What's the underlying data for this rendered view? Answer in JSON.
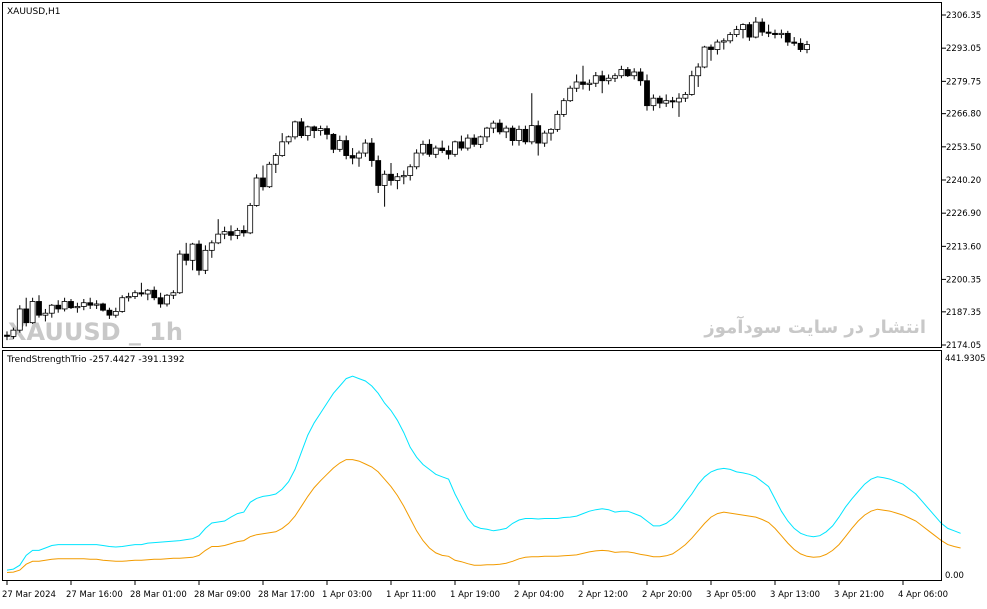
{
  "window": {
    "symbol_label": "XAUUSD,H1"
  },
  "watermark": {
    "symbol": "XAUUSD _ 1h",
    "persian": "انتشار در سایت سودآموز"
  },
  "indicator": {
    "label": "TrendStrengthTrio -257.4427 -391.1392"
  },
  "colors": {
    "background": "#ffffff",
    "border": "#000000",
    "bull_candle": "#ffffff",
    "bear_candle": "#000000",
    "line_cyan": "#00e5ff",
    "line_orange": "#f29b00",
    "watermark": "#c8c8c8"
  },
  "chart_data": [
    {
      "type": "candlestick",
      "title": "XAUUSD,H1",
      "ylim": [
        2174.05,
        2306.35
      ],
      "y_ticks": [
        "2306.35",
        "2293.05",
        "2279.75",
        "2266.80",
        "2253.50",
        "2240.20",
        "2226.90",
        "2213.60",
        "2200.35",
        "2187.35",
        "2174.05"
      ],
      "x_labels": [
        "27 Mar 2024",
        "27 Mar 16:00",
        "28 Mar 01:00",
        "28 Mar 09:00",
        "28 Mar 17:00",
        "1 Apr 03:00",
        "1 Apr 11:00",
        "1 Apr 19:00",
        "2 Apr 04:00",
        "2 Apr 12:00",
        "2 Apr 20:00",
        "3 Apr 05:00",
        "3 Apr 13:00",
        "3 Apr 21:00",
        "4 Apr 06:00"
      ],
      "x_label_every": 10,
      "candles": [
        [
          2178.0,
          2179.5,
          2176.0,
          2177.5
        ],
        [
          2177.5,
          2181.0,
          2176.5,
          2180.0
        ],
        [
          2180.0,
          2190.0,
          2179.0,
          2188.5
        ],
        [
          2188.5,
          2193.0,
          2181.5,
          2183.0
        ],
        [
          2183.0,
          2193.0,
          2182.5,
          2191.5
        ],
        [
          2191.5,
          2194.0,
          2185.0,
          2186.0
        ],
        [
          2186.0,
          2188.5,
          2183.5,
          2186.8
        ],
        [
          2186.8,
          2190.5,
          2185.0,
          2190.0
        ],
        [
          2190.0,
          2192.0,
          2187.0,
          2188.5
        ],
        [
          2188.5,
          2193.0,
          2187.5,
          2191.5
        ],
        [
          2191.5,
          2192.5,
          2188.5,
          2189.0
        ],
        [
          2189.0,
          2191.0,
          2187.0,
          2189.5
        ],
        [
          2189.5,
          2192.5,
          2188.0,
          2191.0
        ],
        [
          2191.0,
          2193.0,
          2188.5,
          2190.0
        ],
        [
          2190.0,
          2192.0,
          2188.5,
          2190.5
        ],
        [
          2190.5,
          2191.0,
          2187.5,
          2188.0
        ],
        [
          2188.0,
          2189.0,
          2184.5,
          2186.0
        ],
        [
          2186.0,
          2189.0,
          2185.0,
          2187.5
        ],
        [
          2187.5,
          2194.0,
          2187.0,
          2193.0
        ],
        [
          2193.0,
          2195.0,
          2191.5,
          2193.5
        ],
        [
          2193.5,
          2196.0,
          2192.5,
          2195.0
        ],
        [
          2195.0,
          2199.0,
          2193.5,
          2194.5
        ],
        [
          2194.5,
          2196.5,
          2192.0,
          2196.0
        ],
        [
          2196.0,
          2197.5,
          2192.0,
          2193.0
        ],
        [
          2193.0,
          2195.0,
          2189.0,
          2190.5
        ],
        [
          2190.5,
          2194.5,
          2189.5,
          2194.0
        ],
        [
          2194.0,
          2196.0,
          2192.5,
          2195.0
        ],
        [
          2195.0,
          2212.0,
          2194.5,
          2210.5
        ],
        [
          2210.5,
          2215.0,
          2206.0,
          2208.0
        ],
        [
          2208.0,
          2215.0,
          2204.0,
          2214.5
        ],
        [
          2214.5,
          2216.0,
          2202.0,
          2204.0
        ],
        [
          2204.0,
          2214.0,
          2202.5,
          2212.0
        ],
        [
          2212.0,
          2216.0,
          2209.0,
          2215.0
        ],
        [
          2215.0,
          2224.5,
          2214.5,
          2218.5
        ],
        [
          2218.5,
          2221.5,
          2216.5,
          2219.5
        ],
        [
          2219.5,
          2222.0,
          2216.0,
          2218.0
        ],
        [
          2218.0,
          2221.0,
          2216.5,
          2220.0
        ],
        [
          2220.0,
          2222.0,
          2217.5,
          2219.0
        ],
        [
          2219.0,
          2231.0,
          2218.5,
          2230.0
        ],
        [
          2230.0,
          2242.5,
          2229.5,
          2241.0
        ],
        [
          2241.0,
          2246.0,
          2236.0,
          2237.5
        ],
        [
          2237.5,
          2247.5,
          2237.0,
          2246.5
        ],
        [
          2246.5,
          2251.0,
          2243.0,
          2250.0
        ],
        [
          2250.0,
          2259.0,
          2249.5,
          2255.5
        ],
        [
          2255.5,
          2258.0,
          2254.5,
          2257.5
        ],
        [
          2257.5,
          2264.0,
          2256.5,
          2263.5
        ],
        [
          2263.5,
          2265.0,
          2257.0,
          2258.0
        ],
        [
          2258.0,
          2262.0,
          2256.0,
          2261.5
        ],
        [
          2261.5,
          2262.0,
          2257.0,
          2260.0
        ],
        [
          2260.0,
          2262.0,
          2258.0,
          2260.8
        ],
        [
          2260.8,
          2262.0,
          2256.5,
          2258.5
        ],
        [
          2258.5,
          2259.0,
          2251.0,
          2252.5
        ],
        [
          2252.5,
          2258.0,
          2251.5,
          2256.0
        ],
        [
          2256.0,
          2258.0,
          2248.5,
          2250.0
        ],
        [
          2250.0,
          2253.0,
          2246.5,
          2249.0
        ],
        [
          2249.0,
          2252.0,
          2245.5,
          2251.0
        ],
        [
          2251.0,
          2256.5,
          2249.5,
          2255.0
        ],
        [
          2255.0,
          2257.0,
          2245.5,
          2248.0
        ],
        [
          2248.0,
          2250.0,
          2235.0,
          2238.0
        ],
        [
          2238.0,
          2244.0,
          2229.5,
          2242.5
        ],
        [
          2242.5,
          2247.0,
          2238.0,
          2240.0
        ],
        [
          2240.0,
          2243.0,
          2236.5,
          2241.5
        ],
        [
          2241.5,
          2244.0,
          2238.5,
          2242.0
        ],
        [
          2242.0,
          2246.5,
          2240.0,
          2245.5
        ],
        [
          2245.5,
          2252.5,
          2244.5,
          2251.0
        ],
        [
          2251.0,
          2256.0,
          2250.0,
          2254.5
        ],
        [
          2254.5,
          2256.5,
          2249.5,
          2250.5
        ],
        [
          2250.5,
          2254.0,
          2249.0,
          2253.0
        ],
        [
          2253.0,
          2256.0,
          2251.0,
          2252.0
        ],
        [
          2252.0,
          2254.0,
          2248.5,
          2250.5
        ],
        [
          2250.5,
          2256.0,
          2249.5,
          2255.5
        ],
        [
          2255.5,
          2258.0,
          2252.0,
          2253.0
        ],
        [
          2253.0,
          2258.5,
          2252.0,
          2257.0
        ],
        [
          2257.0,
          2258.5,
          2253.5,
          2254.5
        ],
        [
          2254.5,
          2258.0,
          2253.0,
          2257.5
        ],
        [
          2257.5,
          2261.5,
          2255.5,
          2261.0
        ],
        [
          2261.0,
          2264.0,
          2259.0,
          2263.0
        ],
        [
          2263.0,
          2264.5,
          2258.5,
          2259.5
        ],
        [
          2259.5,
          2262.0,
          2257.0,
          2261.0
        ],
        [
          2261.0,
          2262.0,
          2254.0,
          2256.0
        ],
        [
          2256.0,
          2262.0,
          2254.0,
          2260.5
        ],
        [
          2260.5,
          2262.0,
          2254.5,
          2255.5
        ],
        [
          2255.5,
          2275.0,
          2254.5,
          2262.0
        ],
        [
          2262.0,
          2264.0,
          2250.0,
          2255.0
        ],
        [
          2255.0,
          2260.0,
          2253.5,
          2259.0
        ],
        [
          2259.0,
          2261.0,
          2256.0,
          2260.5
        ],
        [
          2260.5,
          2268.0,
          2259.5,
          2266.5
        ],
        [
          2266.5,
          2273.0,
          2265.5,
          2272.0
        ],
        [
          2272.0,
          2278.0,
          2271.5,
          2277.0
        ],
        [
          2277.0,
          2282.5,
          2275.5,
          2279.5
        ],
        [
          2279.5,
          2286.0,
          2276.5,
          2278.5
        ],
        [
          2278.5,
          2280.5,
          2276.0,
          2279.0
        ],
        [
          2279.0,
          2283.5,
          2277.5,
          2282.0
        ],
        [
          2282.0,
          2284.0,
          2275.0,
          2280.0
        ],
        [
          2280.0,
          2282.5,
          2278.5,
          2281.0
        ],
        [
          2281.0,
          2283.0,
          2279.5,
          2282.0
        ],
        [
          2282.0,
          2286.0,
          2281.0,
          2284.5
        ],
        [
          2284.5,
          2285.5,
          2281.5,
          2282.0
        ],
        [
          2282.0,
          2285.0,
          2280.5,
          2283.5
        ],
        [
          2283.5,
          2285.0,
          2278.0,
          2280.0
        ],
        [
          2280.0,
          2282.5,
          2268.0,
          2270.0
        ],
        [
          2270.0,
          2274.5,
          2268.0,
          2273.0
        ],
        [
          2273.0,
          2274.0,
          2269.0,
          2271.0
        ],
        [
          2271.0,
          2274.5,
          2269.5,
          2272.0
        ],
        [
          2272.0,
          2273.5,
          2269.0,
          2271.5
        ],
        [
          2271.5,
          2275.0,
          2265.5,
          2273.0
        ],
        [
          2273.0,
          2275.5,
          2271.5,
          2274.5
        ],
        [
          2274.5,
          2284.0,
          2274.0,
          2282.0
        ],
        [
          2282.0,
          2287.0,
          2277.5,
          2285.5
        ],
        [
          2285.5,
          2294.0,
          2285.0,
          2293.5
        ],
        [
          2293.5,
          2294.5,
          2288.0,
          2292.5
        ],
        [
          2292.5,
          2296.5,
          2290.5,
          2295.5
        ],
        [
          2295.5,
          2297.0,
          2292.5,
          2296.0
        ],
        [
          2296.0,
          2299.5,
          2295.0,
          2298.5
        ],
        [
          2298.5,
          2302.0,
          2297.5,
          2300.5
        ],
        [
          2300.5,
          2303.0,
          2297.0,
          2302.5
        ],
        [
          2302.5,
          2303.5,
          2296.0,
          2297.5
        ],
        [
          2297.5,
          2305.5,
          2297.0,
          2303.5
        ],
        [
          2303.5,
          2305.0,
          2298.0,
          2299.5
        ],
        [
          2299.5,
          2302.5,
          2297.5,
          2299.0
        ],
        [
          2299.0,
          2300.5,
          2297.0,
          2298.5
        ],
        [
          2298.5,
          2300.5,
          2297.0,
          2299.0
        ],
        [
          2299.0,
          2300.0,
          2294.0,
          2295.5
        ],
        [
          2295.5,
          2297.5,
          2294.0,
          2295.0
        ],
        [
          2295.0,
          2297.0,
          2291.5,
          2292.5
        ],
        [
          2292.5,
          2296.0,
          2291.0,
          2294.5
        ]
      ]
    },
    {
      "type": "line",
      "title": "TrendStrengthTrio -257.4427 -391.1392",
      "ylim": [
        0,
        441.9305
      ],
      "y_ticks": [
        "441.9305",
        "0.00"
      ],
      "series": [
        {
          "name": "cyan",
          "color": "#00e5ff",
          "values": [
            10,
            12,
            20,
            40,
            50,
            50,
            55,
            60,
            62,
            62,
            62,
            62,
            62,
            62,
            62,
            60,
            58,
            57,
            58,
            60,
            62,
            62,
            65,
            66,
            67,
            68,
            69,
            70,
            72,
            74,
            80,
            95,
            106,
            108,
            110,
            118,
            125,
            128,
            148,
            156,
            160,
            162,
            165,
            175,
            190,
            215,
            250,
            285,
            310,
            330,
            350,
            370,
            385,
            400,
            405,
            400,
            395,
            385,
            370,
            350,
            335,
            315,
            290,
            260,
            240,
            225,
            215,
            205,
            200,
            195,
            165,
            140,
            115,
            100,
            95,
            93,
            90,
            92,
            95,
            105,
            112,
            115,
            115,
            114,
            115,
            115,
            115,
            117,
            118,
            120,
            125,
            130,
            133,
            135,
            133,
            128,
            130,
            130,
            125,
            120,
            110,
            100,
            100,
            105,
            115,
            130,
            148,
            165,
            185,
            200,
            210,
            215,
            217,
            215,
            210,
            208,
            205,
            200,
            190,
            180,
            155,
            130,
            110,
            95,
            85,
            80,
            78,
            80,
            88,
            100,
            118,
            138,
            155,
            170,
            185,
            195,
            200,
            198,
            195,
            190,
            185,
            175,
            165,
            150,
            135,
            120,
            105,
            95,
            90,
            85
          ]
        },
        {
          "name": "orange",
          "color": "#f29b00",
          "values": [
            5,
            6,
            10,
            22,
            28,
            28,
            30,
            32,
            33,
            33,
            33,
            33,
            33,
            32,
            32,
            30,
            29,
            28,
            28,
            29,
            30,
            30,
            31,
            32,
            32,
            33,
            34,
            34,
            35,
            36,
            40,
            50,
            58,
            58,
            60,
            64,
            68,
            70,
            78,
            82,
            84,
            86,
            88,
            95,
            105,
            120,
            140,
            160,
            178,
            192,
            205,
            218,
            228,
            235,
            235,
            232,
            226,
            220,
            210,
            195,
            180,
            162,
            140,
            115,
            90,
            70,
            55,
            45,
            40,
            38,
            30,
            27,
            23,
            20,
            20,
            21,
            21,
            22,
            24,
            28,
            33,
            36,
            37,
            37,
            38,
            38,
            38,
            39,
            40,
            41,
            44,
            47,
            49,
            50,
            49,
            46,
            47,
            47,
            45,
            42,
            40,
            37,
            37,
            39,
            43,
            52,
            62,
            75,
            90,
            105,
            118,
            125,
            128,
            126,
            124,
            122,
            120,
            118,
            113,
            107,
            95,
            80,
            65,
            52,
            43,
            38,
            36,
            37,
            42,
            50,
            62,
            78,
            95,
            110,
            122,
            130,
            134,
            132,
            130,
            126,
            122,
            116,
            110,
            100,
            90,
            80,
            70,
            62,
            58,
            55
          ]
        }
      ]
    }
  ]
}
